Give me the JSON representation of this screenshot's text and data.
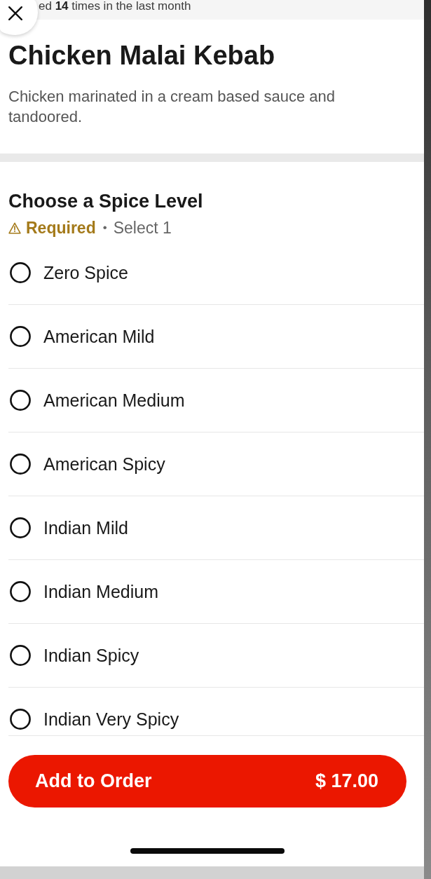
{
  "banner": {
    "text": "ed **14** times in the last month"
  },
  "item": {
    "title": "Chicken Malai Kebab",
    "description": "Chicken marinated in a cream based sauce and tandoored."
  },
  "option_group": {
    "title": "Choose a Spice Level",
    "required": "Required",
    "separator": "•",
    "rule": "Select 1",
    "options": [
      {
        "label": "Zero Spice",
        "selected": false
      },
      {
        "label": "American Mild",
        "selected": false
      },
      {
        "label": "American Medium",
        "selected": false
      },
      {
        "label": "American Spicy",
        "selected": false
      },
      {
        "label": "Indian Mild",
        "selected": false
      },
      {
        "label": "Indian Medium",
        "selected": false
      },
      {
        "label": "Indian Spicy",
        "selected": false
      },
      {
        "label": "Indian Very Spicy",
        "selected": false
      }
    ]
  },
  "order_button": {
    "label": "Add to Order",
    "price": "$ 17.00"
  }
}
